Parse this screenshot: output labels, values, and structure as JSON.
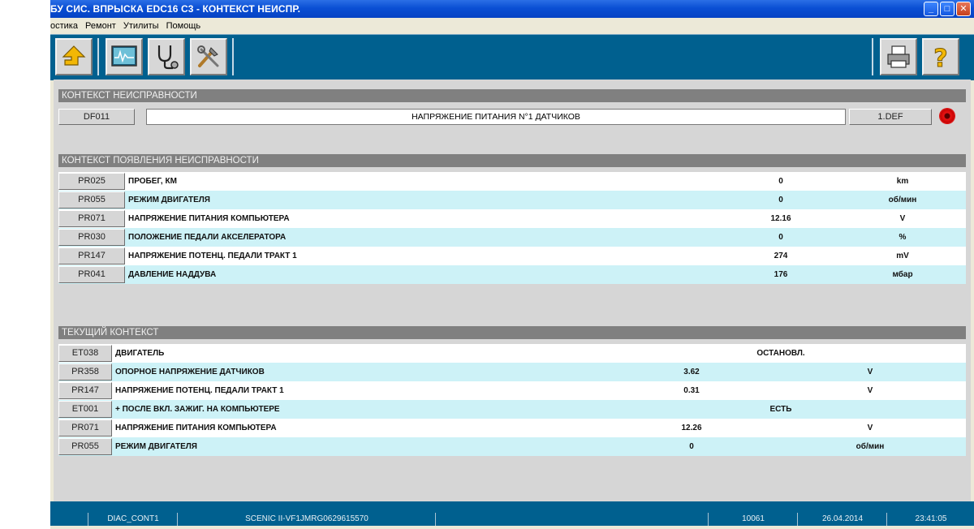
{
  "window": {
    "title": "БУ СИС. ВПРЫСКА EDC16 C3 - КОНТЕКСТ НЕИСПР.",
    "buttons": {
      "minimize": "_",
      "maximize": "□",
      "close": "✕"
    }
  },
  "menu": [
    "остика",
    "Ремонт",
    "Утилиты",
    "Помощь"
  ],
  "toolbar": {
    "left_icons": [
      "up-arrow-icon",
      "oscilloscope-icon",
      "stethoscope-icon",
      "tools-icon"
    ],
    "right_icons": [
      "printer-icon",
      "help-icon"
    ]
  },
  "fault_context": {
    "header": "КОНТЕКСТ НЕИСПРАВНОСТИ",
    "code": "DF011",
    "description": "НАПРЯЖЕНИЕ ПИТАНИЯ N°1 ДАТЧИКОВ",
    "status": "1.DEF",
    "indicator_color": "#e01010"
  },
  "occurrence_context": {
    "header": "КОНТЕКСТ ПОЯВЛЕНИЯ НЕИСПРАВНОСТИ",
    "rows": [
      {
        "code": "PR025",
        "label": "ПРОБЕГ, КМ",
        "value": "0",
        "unit": "km"
      },
      {
        "code": "PR055",
        "label": "РЕЖИМ ДВИГАТЕЛЯ",
        "value": "0",
        "unit": "об/мин"
      },
      {
        "code": "PR071",
        "label": "НАПРЯЖЕНИЕ ПИТАНИЯ КОМПЬЮТЕРА",
        "value": "12.16",
        "unit": "V"
      },
      {
        "code": "PR030",
        "label": "ПОЛОЖЕНИЕ ПЕДАЛИ АКСЕЛЕРАТОРА",
        "value": "0",
        "unit": "%"
      },
      {
        "code": "PR147",
        "label": "НАПРЯЖЕНИЕ ПОТЕНЦ. ПЕДАЛИ ТРАКТ 1",
        "value": "274",
        "unit": "mV"
      },
      {
        "code": "PR041",
        "label": "ДАВЛЕНИЕ НАДДУВА",
        "value": "176",
        "unit": "мбар"
      }
    ]
  },
  "current_context": {
    "header": "ТЕКУЩИЙ КОНТЕКСТ",
    "rows": [
      {
        "code": "ET038",
        "label": "ДВИГАТЕЛЬ",
        "state": "ОСТАНОВЛ."
      },
      {
        "code": "PR358",
        "label": "ОПОРНОЕ НАПРЯЖЕНИЕ ДАТЧИКОВ",
        "value": "3.62",
        "unit": "V"
      },
      {
        "code": "PR147",
        "label": "НАПРЯЖЕНИЕ ПОТЕНЦ. ПЕДАЛИ ТРАКТ 1",
        "value": "0.31",
        "unit": "V"
      },
      {
        "code": "ET001",
        "label": "+ ПОСЛЕ ВКЛ. ЗАЖИГ. НА КОМПЬЮТЕРЕ",
        "state": "ЕСТЬ"
      },
      {
        "code": "PR071",
        "label": "НАПРЯЖЕНИЕ ПИТАНИЯ КОМПЬЮТЕРА",
        "value": "12.26",
        "unit": "V"
      },
      {
        "code": "PR055",
        "label": "РЕЖИМ ДВИГАТЕЛЯ",
        "value": "0",
        "unit": "об/мин"
      }
    ]
  },
  "statusbar": {
    "cells": [
      "",
      "DIAC_CONT1",
      "SCENIC II-VF1JMRG0629615570",
      "",
      "10061",
      "26.04.2014",
      "23:41:05"
    ]
  }
}
